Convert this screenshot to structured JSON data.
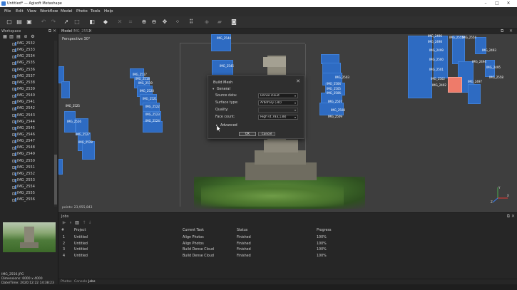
{
  "window": {
    "title": "Untitled* — Agisoft Metashape",
    "minimize_glyph": "–",
    "maximize_glyph": "□",
    "close_glyph": "✕"
  },
  "menu": [
    "File",
    "Edit",
    "View",
    "Workflow",
    "Model",
    "Photo",
    "Tools",
    "Help"
  ],
  "toolbar_icons": [
    "new-icon",
    "open-icon",
    "save-icon",
    "undo-icon",
    "redo-icon",
    "select-icon",
    "rect-select-icon",
    "camera-tool-icon",
    "region-icon",
    "delete-icon",
    "crop-icon",
    "navigate-icon",
    "zoom-in-icon",
    "zoom-out-icon",
    "reset-view-icon",
    "move-icon",
    "grid-icon",
    "points-icon",
    "model-icon",
    "shading-icon",
    "capture-icon",
    "texture-icon"
  ],
  "workspace": {
    "title": "Workspace",
    "cameras": [
      "IMG_2532",
      "IMG_2533",
      "IMG_2534",
      "IMG_2535",
      "IMG_2536",
      "IMG_2537",
      "IMG_2538",
      "IMG_2539",
      "IMG_2540",
      "IMG_2541",
      "IMG_2542",
      "IMG_2543",
      "IMG_2544",
      "IMG_2545",
      "IMG_2546",
      "IMG_2547",
      "IMG_2548",
      "IMG_2549",
      "IMG_2550",
      "IMG_2551",
      "IMG_2552",
      "IMG_2553",
      "IMG_2554",
      "IMG_2555",
      "IMG_2556"
    ]
  },
  "preview": {
    "filename": "IMG_2556.JPG",
    "dimensions": "Dimensions: 6000 x 4000",
    "datetime": "Date/Time: 2020:12:22 14:38:23"
  },
  "viewport": {
    "tab_model": "Model",
    "tab_image": "IMG_2552",
    "projection": "Perspective 30°",
    "points": "points: 23,955,843",
    "camera_labels": [
      "IMG_2544",
      "IMG_2545",
      "IMG_2517",
      "IMG_2518",
      "IMG_2519",
      "IMG_2520",
      "IMG_2521",
      "IMG_2522",
      "IMG_2523",
      "IMG_2524",
      "IMG_2525",
      "IMG_2526",
      "IMG_2527",
      "IMG_2528",
      "IMG_2529",
      "IMG_2503",
      "IMG_2504",
      "IMG_2505",
      "IMG_2506",
      "IMG_2507",
      "IMG_2508",
      "IMG_2509",
      "IMG_2496",
      "IMG_2555",
      "IMG_2554",
      "IMG_2498",
      "IMG_2499",
      "IMG_2500",
      "IMG_2501",
      "IMG_2502",
      "IMG_2492",
      "IMG_2493",
      "IMG_2494",
      "IMG_2495",
      "IMG_2558",
      "IMG_2497"
    ],
    "axis_x": "X",
    "axis_y": "Y",
    "axis_z": "Z"
  },
  "dialog": {
    "title": "Build Mesh",
    "general": "General",
    "advanced": "Advanced",
    "fields": [
      {
        "label": "Source data:",
        "value": "Dense cloud"
      },
      {
        "label": "Surface type:",
        "value": "Arbitrary (3D)"
      },
      {
        "label": "Quality:",
        "value": ""
      },
      {
        "label": "Face count:",
        "value": "High (4,783,138)"
      }
    ],
    "ok": "OK",
    "cancel": "Cancel"
  },
  "jobs": {
    "title": "Jobs",
    "columns": [
      "#",
      "Project",
      "Current Task",
      "Status",
      "Progress"
    ],
    "rows": [
      [
        "1",
        "Untitled",
        "Align Photos",
        "Finished",
        "100%"
      ],
      [
        "2",
        "Untitled",
        "Align Photos",
        "Finished",
        "100%"
      ],
      [
        "3",
        "Untitled",
        "Build Dense Cloud",
        "Finished",
        "100%"
      ],
      [
        "4",
        "Untitled",
        "Build Dense Cloud",
        "Finished",
        "100%"
      ]
    ]
  },
  "bottom_tabs": [
    "Photos",
    "Console",
    "Jobs"
  ],
  "colors": {
    "camera": "#2e6bc2",
    "camera_selected": "#ee7b6a",
    "background": "#3e3e3e"
  }
}
